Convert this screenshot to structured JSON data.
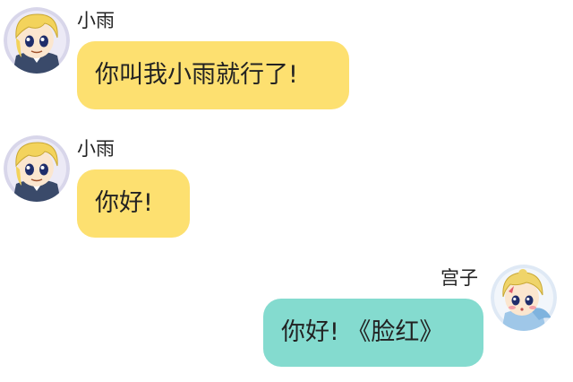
{
  "colors": {
    "left_bubble": "#fde070",
    "right_bubble": "#84dbcf",
    "background": "#ffffff"
  },
  "messages": [
    {
      "side": "left",
      "sender": "小雨",
      "text": "你叫我小雨就行了!",
      "avatar": "blonde-boy-avatar"
    },
    {
      "side": "left",
      "sender": "小雨",
      "text": "你好!",
      "avatar": "blonde-boy-avatar"
    },
    {
      "side": "right",
      "sender": "宫子",
      "text": "你好! 《脸红》",
      "avatar": "blonde-girl-avatar"
    }
  ]
}
